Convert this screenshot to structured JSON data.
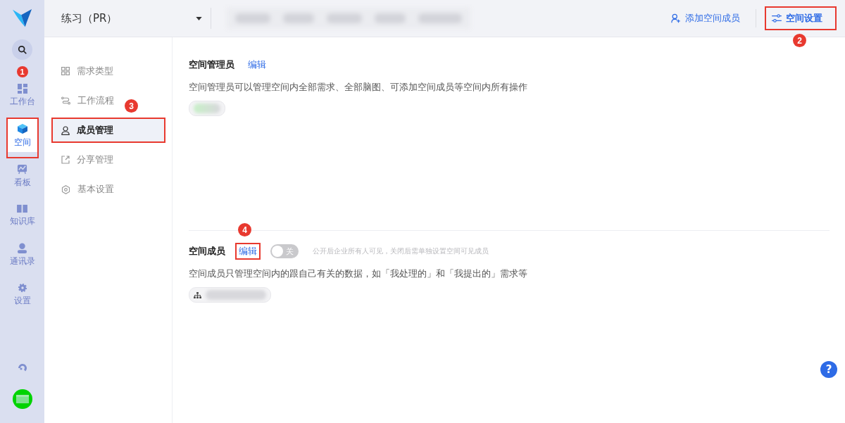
{
  "rail": {
    "items": [
      {
        "kind": "dashboard",
        "label": "工作台",
        "selected": false,
        "highlighted": false,
        "annotation": "1"
      },
      {
        "kind": "space",
        "label": "空间",
        "selected": true,
        "highlighted": true
      },
      {
        "kind": "board",
        "label": "看板",
        "selected": false,
        "highlighted": false
      },
      {
        "kind": "book",
        "label": "知识库",
        "selected": false,
        "highlighted": false
      },
      {
        "kind": "contact",
        "label": "通讯录",
        "selected": false,
        "highlighted": false
      },
      {
        "kind": "gear",
        "label": "设置",
        "selected": false,
        "highlighted": false
      }
    ]
  },
  "top_bar": {
    "project": "练习（PR）",
    "add_member": "添加空间成员",
    "settings": {
      "label": "空间设置",
      "highlighted": true,
      "annotation": "2"
    }
  },
  "nav": {
    "items": [
      {
        "kind": "grid",
        "label": "需求类型",
        "selected": false,
        "highlighted": false
      },
      {
        "kind": "flow",
        "label": "工作流程",
        "selected": false,
        "highlighted": false
      },
      {
        "kind": "person",
        "label": "成员管理",
        "selected": true,
        "highlighted": true,
        "annotation": "3"
      },
      {
        "kind": "share",
        "label": "分享管理",
        "selected": false,
        "highlighted": false
      },
      {
        "kind": "gear",
        "label": "基本设置",
        "selected": false,
        "highlighted": false
      }
    ]
  },
  "admins": {
    "title": "空间管理员",
    "edit": {
      "label": "编辑",
      "highlighted": false
    },
    "description": "空间管理员可以管理空间内全部需求、全部脑图、可添加空间成员等空间内所有操作"
  },
  "members": {
    "title": "空间成员",
    "edit": {
      "label": "编辑",
      "highlighted": true,
      "annotation": "4"
    },
    "toggle": {
      "on": false,
      "label": "关"
    },
    "hint": "公开后企业所有人可见，关闭后需单独设置空间可见成员",
    "description": "空间成员只管理空间内的跟自己有关的数据，如「我处理的」和「我提出的」需求等"
  },
  "help": "?"
}
